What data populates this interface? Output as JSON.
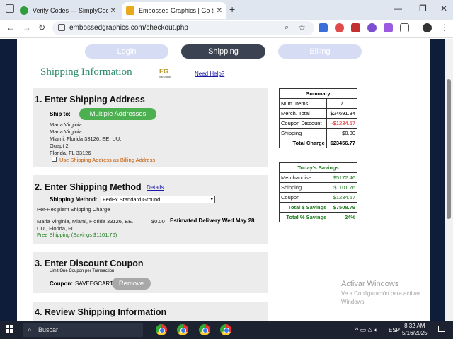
{
  "browser": {
    "tabs": [
      {
        "title": "Verify Codes — SimplyCodes",
        "active": false,
        "favicon_color": "#2e9e3a"
      },
      {
        "title": "Embossed Graphics | Go to Che",
        "active": true,
        "favicon_color": "#e9a91b"
      }
    ],
    "url": "embossedgraphics.com/checkout.php",
    "new_tab_glyph": "+"
  },
  "steps": {
    "login": "Login",
    "shipping": "Shipping",
    "billing": "Billing"
  },
  "header": {
    "title": "Shipping Information",
    "logo_text": "EG",
    "logo_sub": "SECURE",
    "help_link": "Need Help?"
  },
  "section1": {
    "heading": "1. Enter Shipping Address",
    "ship_to_label": "Ship to:",
    "multiple_button": "Multiple Addresses",
    "address_lines": [
      "Maria Virginia",
      "Maria Virginia",
      "Miami, Florida 33126, EE. UU.",
      "Guapt 2",
      "Florida, FL 33126"
    ],
    "billing_checkbox_label": "Use Shipping Address as Billing Address"
  },
  "section2": {
    "heading": "2. Enter Shipping Method",
    "details_link": "Details",
    "method_label": "Shipping Method:",
    "method_value": "FedEx Standard Ground",
    "per_recipient": "Per-Recipient Shipping Charge",
    "recipient_line1": "Maria Virginia, Miami, Florida 33126, EE.",
    "recipient_line2": "UU., Florida, FL",
    "price": "$0.00",
    "delivery": "Estimated Delivery Wed May 28",
    "free_shipping": "Free Shipping (Savings $1101.76)"
  },
  "section3": {
    "heading": "3. Enter Discount Coupon",
    "limit_note": "Limit One Coupon per Transaction",
    "coupon_label": "Coupon:",
    "coupon_code": "SAVEEGCART",
    "remove_button": "Remove"
  },
  "section4": {
    "heading": "4. Review Shipping Information"
  },
  "summary": {
    "title": "Summary",
    "rows": [
      {
        "label": "Num. Items",
        "value": "7"
      },
      {
        "label": "Merch. Total",
        "value": "$24691.34"
      },
      {
        "label": "Coupon Discount",
        "value": "-$1234.57"
      },
      {
        "label": "Shipping",
        "value": "$0.00"
      }
    ],
    "total_label": "Total Charge",
    "total_value": "$23456.77"
  },
  "savings": {
    "title": "Today's Savings",
    "rows": [
      {
        "label": "Merchandise",
        "value": "$5172.46"
      },
      {
        "label": "Shipping",
        "value": "$1101.76"
      },
      {
        "label": "Coupon",
        "value": "$1234.57"
      }
    ],
    "total_label": "Total $ Savings",
    "total_value": "$7508.79",
    "pct_label": "Total % Savings",
    "pct_value": "24%"
  },
  "watermark": {
    "title": "Activar Windows",
    "subtitle": "Ve a Configuración para activar Windows."
  },
  "taskbar": {
    "search": "Buscar",
    "time": "8:32 AM",
    "date": "5/16/2025",
    "lang": "ESP"
  },
  "colors": {
    "accent_green": "#4caf50",
    "title_green": "#2b8a6a",
    "page_navy": "#0d1d3a",
    "discount_red": "#d22020",
    "savings_green": "#1f7d1f"
  }
}
